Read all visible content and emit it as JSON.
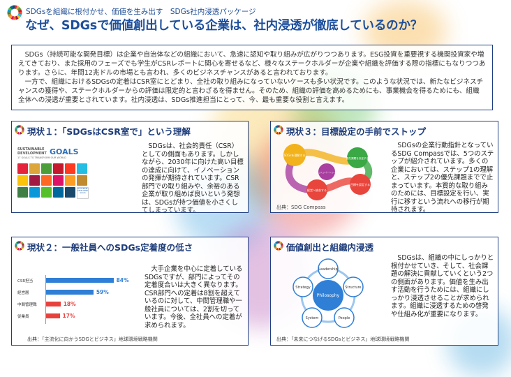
{
  "header": {
    "subtitle": "SDGsを組織に根付かせ、価値を生み出す　SDGs社内浸透パッケージ",
    "title": "なぜ、SDGsで価値創出している企業は、社内浸透が徹底しているのか？"
  },
  "intro": {
    "para1": "SDGs（持続可能な開発目標）は企業や自治体などの組織において、急速に認知や取り組みが広がりつつあります。ESG投資を重要視する機関投資家や増えてきており、また採用のフェーズでも学生がCSRレポートに関心を寄せるなど、様々なステークホルダーが企業や組織を評価する際の指標にもなりつつあります。さらに、年間12兆ドルの市場とも言われ、多くのビジネスチャンスがあると言われております。",
    "para2": "一方で、組織におけるSDGsの定着はCSR室にとどまり、全社の取り組みになっていないケースも多い状況です。このような状況では、新たなビジネスチャンスの獲得や、ステークホルダーからの評価は限定的と言わざるを得ません。そのため、組織の評価を高めるためにも、事業機会を得るためにも、組織全体への浸透が重要とされています。社内浸透は、SDGs推進担当にとって、今、最も重要な役割と言えます。"
  },
  "panel1": {
    "title": "現状１：「SDGsはCSR室で」という理解",
    "text": "SDGsは、社会的責任（CSR）としての側面もあります。しかしながら、2030年に向けた高い目標の達成に向けて、イノベーションの発揮が期待されています。CSR部門での取り組みや、余裕のある企業が取り組めば良いという発想は、SDGsが持つ価値を小さくしてしまっています。",
    "logo": {
      "line1": "SUSTAINABLE",
      "line2": "DEVELOPMENT",
      "goals": "GOALS",
      "tagline": "17 GOALS TO TRANSFORM OUR WORLD",
      "tile_goals_1": "SUSTAINABLE",
      "tile_goals_2": "DEVELOPMENT",
      "tile_goals_3": "GOALS"
    },
    "tile_colors": [
      "#e5243b",
      "#dda63a",
      "#4c9f38",
      "#c5192d",
      "#ff3a21",
      "#26bde2",
      "#fcc30b",
      "#a21942",
      "#fd6925",
      "#dd1367",
      "#fd9d24",
      "#bf8b2e",
      "#3f7e44",
      "#0a97d9",
      "#56c02b",
      "#00689d",
      "#19486a"
    ]
  },
  "panel2": {
    "title": "現状２：一般社員へのSDGs定着度の低さ",
    "text": "大手企業を中心に定着しているSDGsですが、部門によってその定着度合いは大きく異なります。CSR部門への定着は8割を超えているのに対して、中間管理職や一般社員については、2割を切っています。今後、全社員への定着が求められます。",
    "source": "出典：「主流化に向かうSDGとビジネス」地球環境戦略機関",
    "chart_data": {
      "type": "bar",
      "categories": [
        "CSR担当",
        "経営層",
        "中間管理職",
        "従業員"
      ],
      "values": [
        84,
        59,
        18,
        17
      ],
      "value_labels": [
        "84%",
        "59%",
        "18%",
        "17%"
      ],
      "colors": [
        "#2f7fd6",
        "#2f7fd6",
        "#e8413c",
        "#e8413c"
      ],
      "xlim": [
        0,
        100
      ]
    }
  },
  "panel3": {
    "title": "現状３：目標設定の手前でストップ",
    "text": "SDGsの企業行動指針となっているSDG Compassでは、5つのステップが紹介されています。多くの企業においては、ステップ1の理解と、ステップ2の優先課題までで止まっています。本質的な取り組みのためには、目標設定を行い、実行に移すという流れへの移行が期待されます。",
    "source": "出典：SDG Compass",
    "steps": [
      "SDGsを理解する",
      "優先課題を決定する",
      "目標を設定する",
      "経営へ統合する",
      "報告とコミュニケーションを行う"
    ],
    "step_colors": [
      "#f2b21c",
      "#39a845",
      "#e8453c",
      "#e8453c",
      "#a93fa0"
    ]
  },
  "panel4": {
    "title": "価値創出と組織内浸透",
    "text": "SDGsは、組織の中にしっかりと根付かせていき、そして、社会課題の解決に貢献していくという2つの側面があります。価値を生み出す活動を行うためには、組織にしっかり浸透させることが求められます。組織に浸透するための啓発や仕組み化が重要になります。",
    "source": "出典：「未来につなげるSDGsとビジネス」地球環境戦略機関",
    "diagram": {
      "center": "Philosophy",
      "nodes": [
        "Leadership",
        "Structure",
        "People",
        "System",
        "Strategy"
      ]
    }
  }
}
